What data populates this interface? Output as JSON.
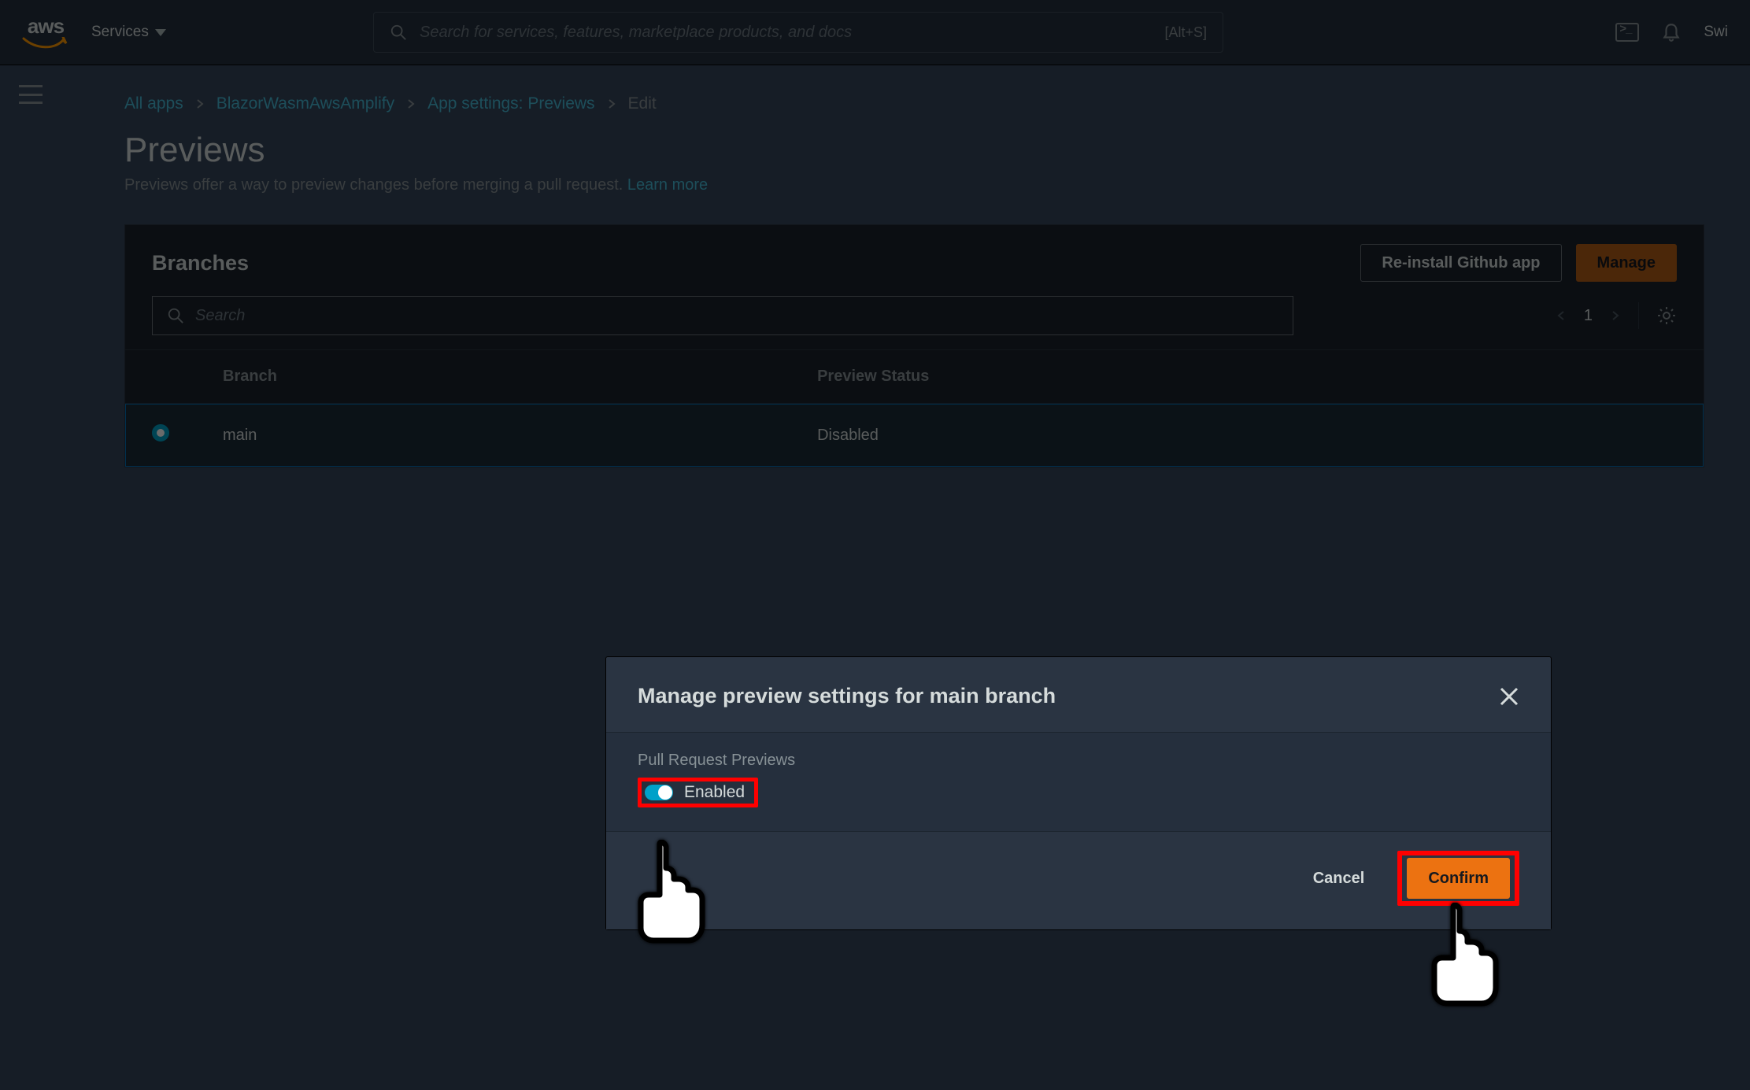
{
  "top": {
    "logo_text": "aws",
    "services_label": "Services",
    "search_placeholder": "Search for services, features, marketplace products, and docs",
    "search_kbd": "[Alt+S]",
    "user_snip": "Swi"
  },
  "crumbs": {
    "all_apps": "All apps",
    "app_name": "BlazorWasmAwsAmplify",
    "settings": "App settings: Previews",
    "edit": "Edit"
  },
  "page": {
    "title": "Previews",
    "subtitle_text": "Previews offer a way to preview changes before merging a pull request. ",
    "learn_more": "Learn more"
  },
  "panel": {
    "title": "Branches",
    "reinstall": "Re-install Github app",
    "manage": "Manage",
    "search_placeholder": "Search",
    "page_number": "1",
    "cols": {
      "branch": "Branch",
      "status": "Preview Status"
    },
    "rows": [
      {
        "branch": "main",
        "status": "Disabled"
      }
    ]
  },
  "modal": {
    "title": "Manage preview settings for main branch",
    "field_label": "Pull Request Previews",
    "enabled_label": "Enabled",
    "cancel": "Cancel",
    "confirm": "Confirm"
  }
}
